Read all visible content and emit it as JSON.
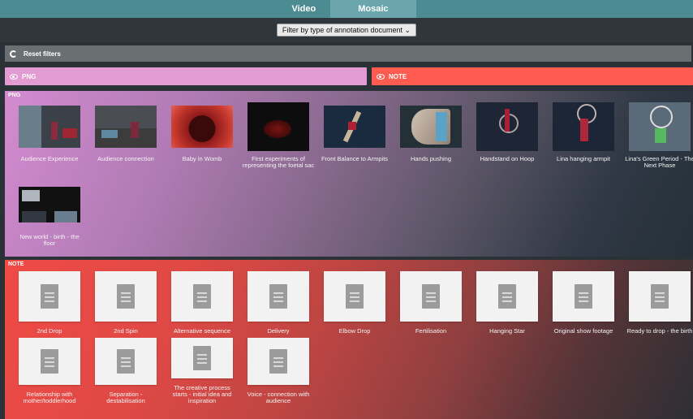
{
  "tabs": [
    {
      "label": "Video",
      "active": false
    },
    {
      "label": "Mosaic",
      "active": true
    }
  ],
  "filter": {
    "selected": "Filter by type of annotation document ⌄"
  },
  "reset": {
    "label": "Reset filters"
  },
  "chips": {
    "png": {
      "label": "PNG",
      "color": "#e39bd4"
    },
    "note": {
      "label": "NOTE",
      "color": "#ff5b50"
    }
  },
  "sections": {
    "png": {
      "label": "PNG",
      "items": [
        {
          "caption": "Audience Experience"
        },
        {
          "caption": "Audience connection"
        },
        {
          "caption": "Baby in Womb"
        },
        {
          "caption": "First experiments of representing the foetal sac"
        },
        {
          "caption": "Front Balance to Armpits"
        },
        {
          "caption": "Hands pushing"
        },
        {
          "caption": "Handstand on Hoop"
        },
        {
          "caption": "Lina hanging armpit"
        },
        {
          "caption": "Lina's Green Period - The Next Phase"
        },
        {
          "caption": "New world - birth - the floor"
        }
      ]
    },
    "note": {
      "label": "NOTE",
      "items": [
        {
          "caption": "2nd Drop"
        },
        {
          "caption": "2nd Spin"
        },
        {
          "caption": "Alternative sequence"
        },
        {
          "caption": "Delivery"
        },
        {
          "caption": "Elbow Drop"
        },
        {
          "caption": "Fertilisation"
        },
        {
          "caption": "Hanging Star"
        },
        {
          "caption": "Original show footage"
        },
        {
          "caption": "Ready to drop - the birth"
        },
        {
          "caption": "Relationship with mother/toddlerhood"
        },
        {
          "caption": "Separation - destabilisation"
        },
        {
          "caption": "The creative process starts - initial idea and inspiration"
        },
        {
          "caption": "Voice - connection with audience"
        }
      ]
    }
  }
}
